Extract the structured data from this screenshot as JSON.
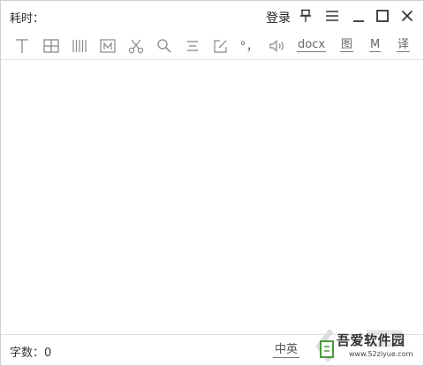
{
  "title_bar": {
    "elapsed_label": "耗时：",
    "login_label": "登录",
    "icons": [
      "pin-icon",
      "menu-icon",
      "minimize-icon",
      "maximize-icon",
      "close-icon"
    ]
  },
  "toolbar": {
    "icons": [
      "text-icon",
      "table-icon",
      "columns-icon",
      "m-box-icon",
      "scissors-icon",
      "search-icon",
      "align-icon",
      "edit-icon",
      "punctuation-icon",
      "speaker-icon"
    ],
    "punctuation_label": "°，",
    "docx_label": "docx",
    "image_label": "图",
    "m_label": "M",
    "translate_label": "译"
  },
  "editor": {
    "content": ""
  },
  "status_bar": {
    "word_count_label": "字数：0",
    "language_label": "中英"
  },
  "watermark": {
    "site_name": "吾爱软件园",
    "url": "www.52ziyue.com"
  }
}
